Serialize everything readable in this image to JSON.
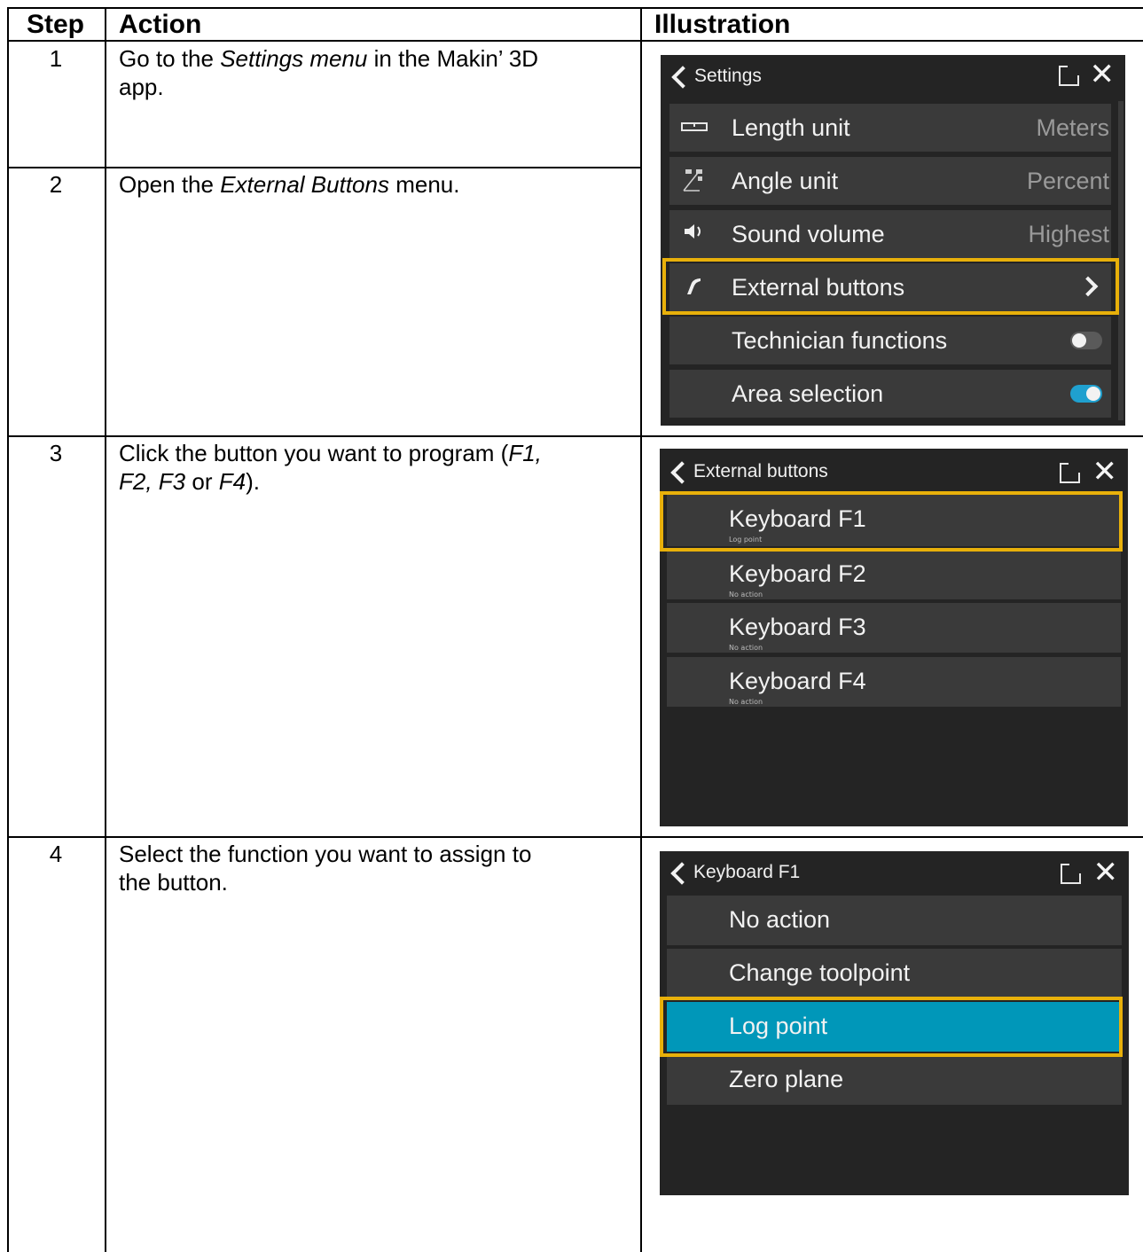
{
  "table": {
    "headers": {
      "step": "Step",
      "action": "Action",
      "illustration": "Illustration"
    },
    "steps": [
      {
        "number": "1",
        "text_pre": "Go to the ",
        "text_em": "Settings menu",
        "text_post": " in the Makin’ 3D",
        "text_line2": "app."
      },
      {
        "number": "2",
        "text_pre": "Open the ",
        "text_em": "External Buttons",
        "text_post": " menu."
      },
      {
        "number": "3",
        "text_line1_pre": "Click the button you want to program (",
        "text_line1_em": "F1,",
        "text_line2_em1": "F2, F3",
        "text_line2_mid": " or ",
        "text_line2_em2": "F4",
        "text_line2_post": ")."
      },
      {
        "number": "4",
        "text_line1": "Select the function you want to assign to",
        "text_line2": "the button."
      }
    ]
  },
  "screens": {
    "settings": {
      "title": "Settings",
      "rows": [
        {
          "icon": "ruler-icon",
          "label": "Length unit",
          "value": "Meters"
        },
        {
          "icon": "angle-icon",
          "label": "Angle unit",
          "value": "Percent"
        },
        {
          "icon": "speaker-icon",
          "label": "Sound volume",
          "value": "Highest"
        },
        {
          "icon": "trigger-icon",
          "label": "External buttons",
          "value": ""
        },
        {
          "icon": "",
          "label": "Technician functions",
          "toggle": false
        },
        {
          "icon": "",
          "label": "Area selection",
          "toggle": true
        }
      ],
      "highlighted": "External buttons"
    },
    "external_buttons": {
      "title": "External buttons",
      "rows": [
        {
          "label": "Keyboard F1",
          "sub": "Log point"
        },
        {
          "label": "Keyboard F2",
          "sub": "No action"
        },
        {
          "label": "Keyboard F3",
          "sub": "No action"
        },
        {
          "label": "Keyboard F4",
          "sub": "No action"
        }
      ],
      "highlighted": "Keyboard F1"
    },
    "keyboard_f1": {
      "title": "Keyboard F1",
      "rows": [
        {
          "label": "No action"
        },
        {
          "label": "Change toolpoint"
        },
        {
          "label": "Log point",
          "selected": true
        },
        {
          "label": "Zero plane"
        }
      ],
      "highlighted": "Log point"
    }
  },
  "colors": {
    "highlight": "#e8b00a",
    "selected": "#0097b9",
    "panel": "#242424",
    "row": "#3a3a3a",
    "toggle_on": "#1fa0cf"
  }
}
